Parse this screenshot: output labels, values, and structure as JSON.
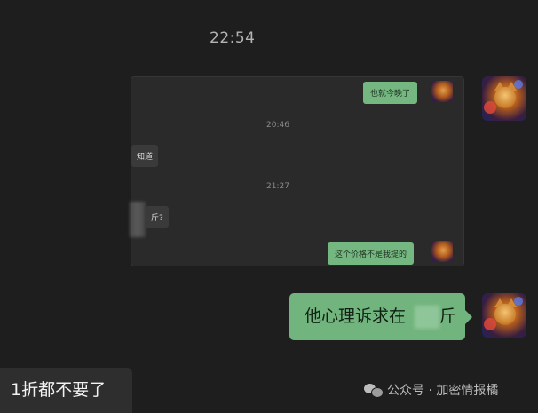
{
  "timestamp_main": "22:54",
  "quoted_chat": {
    "messages": [
      {
        "kind": "sent",
        "text": "也就今晚了"
      },
      {
        "kind": "time",
        "text": "20:46"
      },
      {
        "kind": "received",
        "text": "知道"
      },
      {
        "kind": "time",
        "text": "21:27"
      },
      {
        "kind": "received",
        "text": "斤?"
      },
      {
        "kind": "sent",
        "text": "这个价格不是我提的"
      }
    ]
  },
  "main_message": {
    "text": "他心理诉求在",
    "suffix": "斤"
  },
  "caption": "1折都不要了",
  "watermark": {
    "icon": "wechat-icon",
    "text": "公众号 · 加密情报橘"
  },
  "colors": {
    "sent_bubble": "#72b47d",
    "background": "#1e1e1e"
  }
}
